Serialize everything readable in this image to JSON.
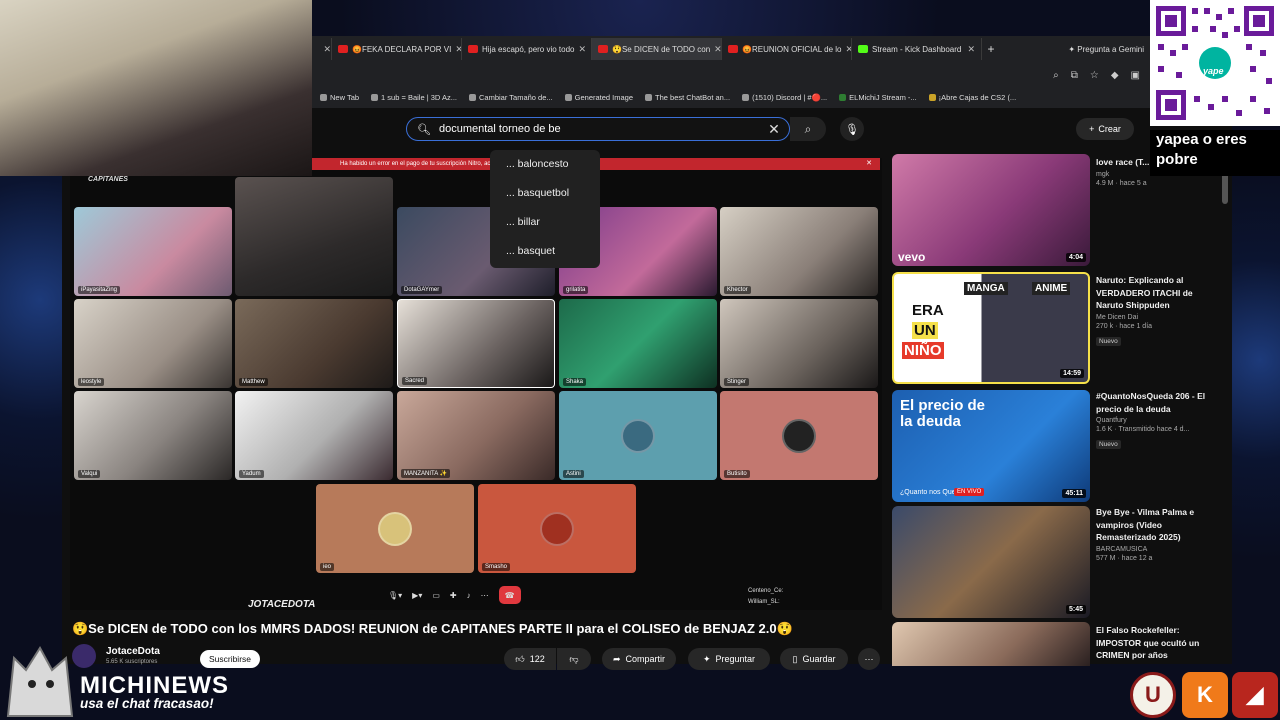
{
  "browser": {
    "tabs": [
      {
        "label": "😡FEKA DECLARA POR VI",
        "icon": "youtube-icon"
      },
      {
        "label": "Hija escapó, pero vio todo",
        "icon": "youtube-icon"
      },
      {
        "label": "😲Se DICEN de TODO con",
        "icon": "youtube-icon"
      },
      {
        "label": "😡REUNION OFICIAL de lo",
        "icon": "youtube-icon"
      },
      {
        "label": "Stream - Kick Dashboard",
        "icon": "kick-icon"
      }
    ],
    "gemini_label": "Pregunta a Gemini",
    "bookmarks": [
      "New Tab",
      "1 sub = Baile | 3D Az...",
      "Cambiar Tamaño de...",
      "Generated Image",
      "The best ChatBot an...",
      "(1510) Discord | #🔴...",
      "ELMichiJ Stream -...",
      "¡Abre Cajas de CS2 (..."
    ]
  },
  "youtube": {
    "search": {
      "value": "documental torneo de be",
      "suggestions": [
        "... baloncesto",
        "... basquetbol",
        "... billar",
        "... basquet"
      ]
    },
    "create_label": "Crear",
    "player": {
      "error_text": "Ha habido un error en el pago de tu suscripción Nitro, actua",
      "server_label": "CAPITANES",
      "channel_watermark": "JOTACEDOTA",
      "participants": [
        "iPayasitaZing",
        "",
        "DotaGAYmer",
        "grilatita",
        "Khector",
        "leostyle",
        "Matthew",
        "Sacred",
        "Shaka",
        "Stinger",
        "Valqui",
        "Yadum",
        "MANZANITA ✨",
        "Astini",
        "Butisito",
        "ieo",
        "Smasho"
      ],
      "mini_chat": [
        "Centeno_Ce:",
        "William_SL:"
      ]
    },
    "video_title": "😲Se DICEN de TODO con los MMRS DADOS! REUNION de CAPITANES PARTE II para el COLISEO de BENJAZ 2.0😲",
    "channel": {
      "name": "JotaceDota",
      "subs": "5.65 K suscriptores",
      "subscribe_label": "Suscribirse"
    },
    "actions": {
      "likes": "122",
      "share": "Compartir",
      "ask": "Preguntar",
      "save": "Guardar"
    },
    "sidebar": [
      {
        "title": "love race (T... DoGeneres S...",
        "channel": "mgk",
        "stats": "4.9 M · hace 5 a",
        "duration": "4:04",
        "badge": ""
      },
      {
        "title": "Naruto: Explicando al VERDADERO ITACHI de Naruto Shippuden",
        "channel": "Me Dicen Dai",
        "stats": "270 k · hace 1 día",
        "duration": "14:59",
        "badge": "Nuevo"
      },
      {
        "title": "#QuantoNosQueda 206 - El precio de la deuda",
        "channel": "Quantfury",
        "stats": "1.6 K · Transmitido hace 4 d...",
        "duration": "45:11",
        "badge": "Nuevo"
      },
      {
        "title": "Bye Bye - Vilma Palma e vampiros (Video Remasterizado 2025)",
        "channel": "BARCAMUSICA",
        "stats": "577 M · hace 12 a",
        "duration": "5:45",
        "badge": ""
      },
      {
        "title": "El Falso Rockefeller: IMPOSTOR que ocultó un CRIMEN por años",
        "channel": "",
        "stats": "",
        "duration": "",
        "badge": ""
      }
    ],
    "thumb_texts": {
      "vevo": "vevo",
      "manga": "MANGA",
      "anime": "ANIME",
      "era": "ERA",
      "un": "UN",
      "nino": "NIÑO",
      "precio": "El precio de la deuda",
      "quanto": "¿Quanto nos Queda?",
      "envivo": "EN VIVO"
    }
  },
  "overlay": {
    "qr_caption": "yapea o eres pobre",
    "qr_brand": "yape",
    "brand_name": "MICHINEWS",
    "brand_sub": "usa el chat fracasao!"
  }
}
